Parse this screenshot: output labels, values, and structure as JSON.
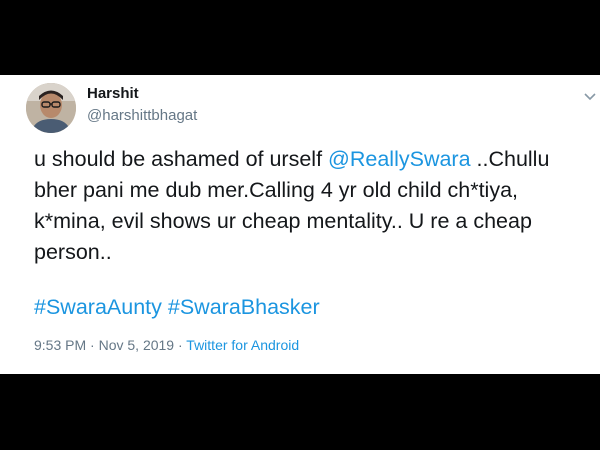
{
  "tweet": {
    "display_name": "Harshit",
    "handle": "@harshittbhagat",
    "avatar_icon": "profile-photo",
    "menu_icon": "chevron-down-icon",
    "text_lines": [
      [
        "u should be ashamed of urself ",
        "@ReallySwara",
        " ..Chullu"
      ],
      "bher pani me dub mer.Calling 4 yr old child ch*tiya,",
      "k*mina, evil shows ur cheap mentality.. U re a cheap",
      "person.."
    ],
    "mention": "@ReallySwara",
    "text_line1_prefix": "u should be ashamed of urself ",
    "text_line1_suffix": " ..Chullu",
    "text_line2": "bher pani me dub mer.Calling 4 yr old child ch*tiya,",
    "text_line3": "k*mina, evil shows ur cheap mentality.. U re a cheap",
    "text_line4": "person..",
    "hashtags": [
      "#SwaraAunty",
      "#SwaraBhasker"
    ],
    "time": "9:53 PM",
    "separator": "·",
    "date": "Nov 5, 2019",
    "source": "Twitter for Android",
    "colors": {
      "link": "#1b95e0",
      "text": "#14171a",
      "secondary": "#657786",
      "letterbox": "#000000"
    }
  }
}
